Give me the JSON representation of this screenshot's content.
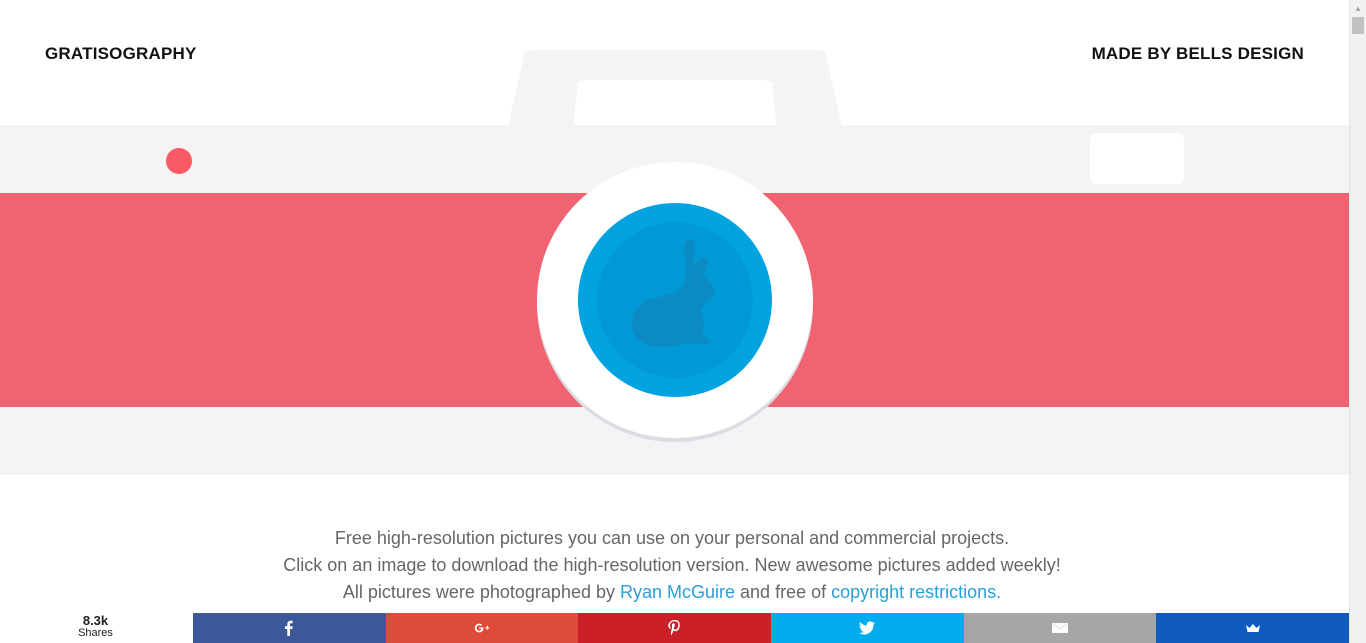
{
  "header": {
    "brand": "GRATISOGRAPHY",
    "credit": "MADE BY BELLS DESIGN"
  },
  "intro": {
    "line1": "Free high-resolution pictures you can use on your personal and commercial projects.",
    "line2": "Click on an image to download the high-resolution version. New awesome pictures added weekly!",
    "line3_prefix": "All pictures were photographed by ",
    "photographer_link": "Ryan McGuire",
    "line3_middle": " and free of ",
    "copyright_link": "copyright restrictions."
  },
  "sharebar": {
    "count": "8.3k",
    "count_label": "Shares",
    "buttons": [
      {
        "network": "facebook",
        "icon": "facebook-icon",
        "color": "#3b5998"
      },
      {
        "network": "google-plus",
        "icon": "google-plus-icon",
        "color": "#dd4b39"
      },
      {
        "network": "pinterest",
        "icon": "pinterest-icon",
        "color": "#cb2027"
      },
      {
        "network": "twitter",
        "icon": "twitter-icon",
        "color": "#00aced"
      },
      {
        "network": "email",
        "icon": "email-icon",
        "color": "#a6a6a6"
      },
      {
        "network": "sumo",
        "icon": "crown-icon",
        "color": "#0e5bbd"
      }
    ]
  },
  "colors": {
    "camera_body": "#f4f3f5",
    "camera_stripe": "#f06472",
    "lens": "#00a3e0",
    "link": "#2a9fd6"
  }
}
